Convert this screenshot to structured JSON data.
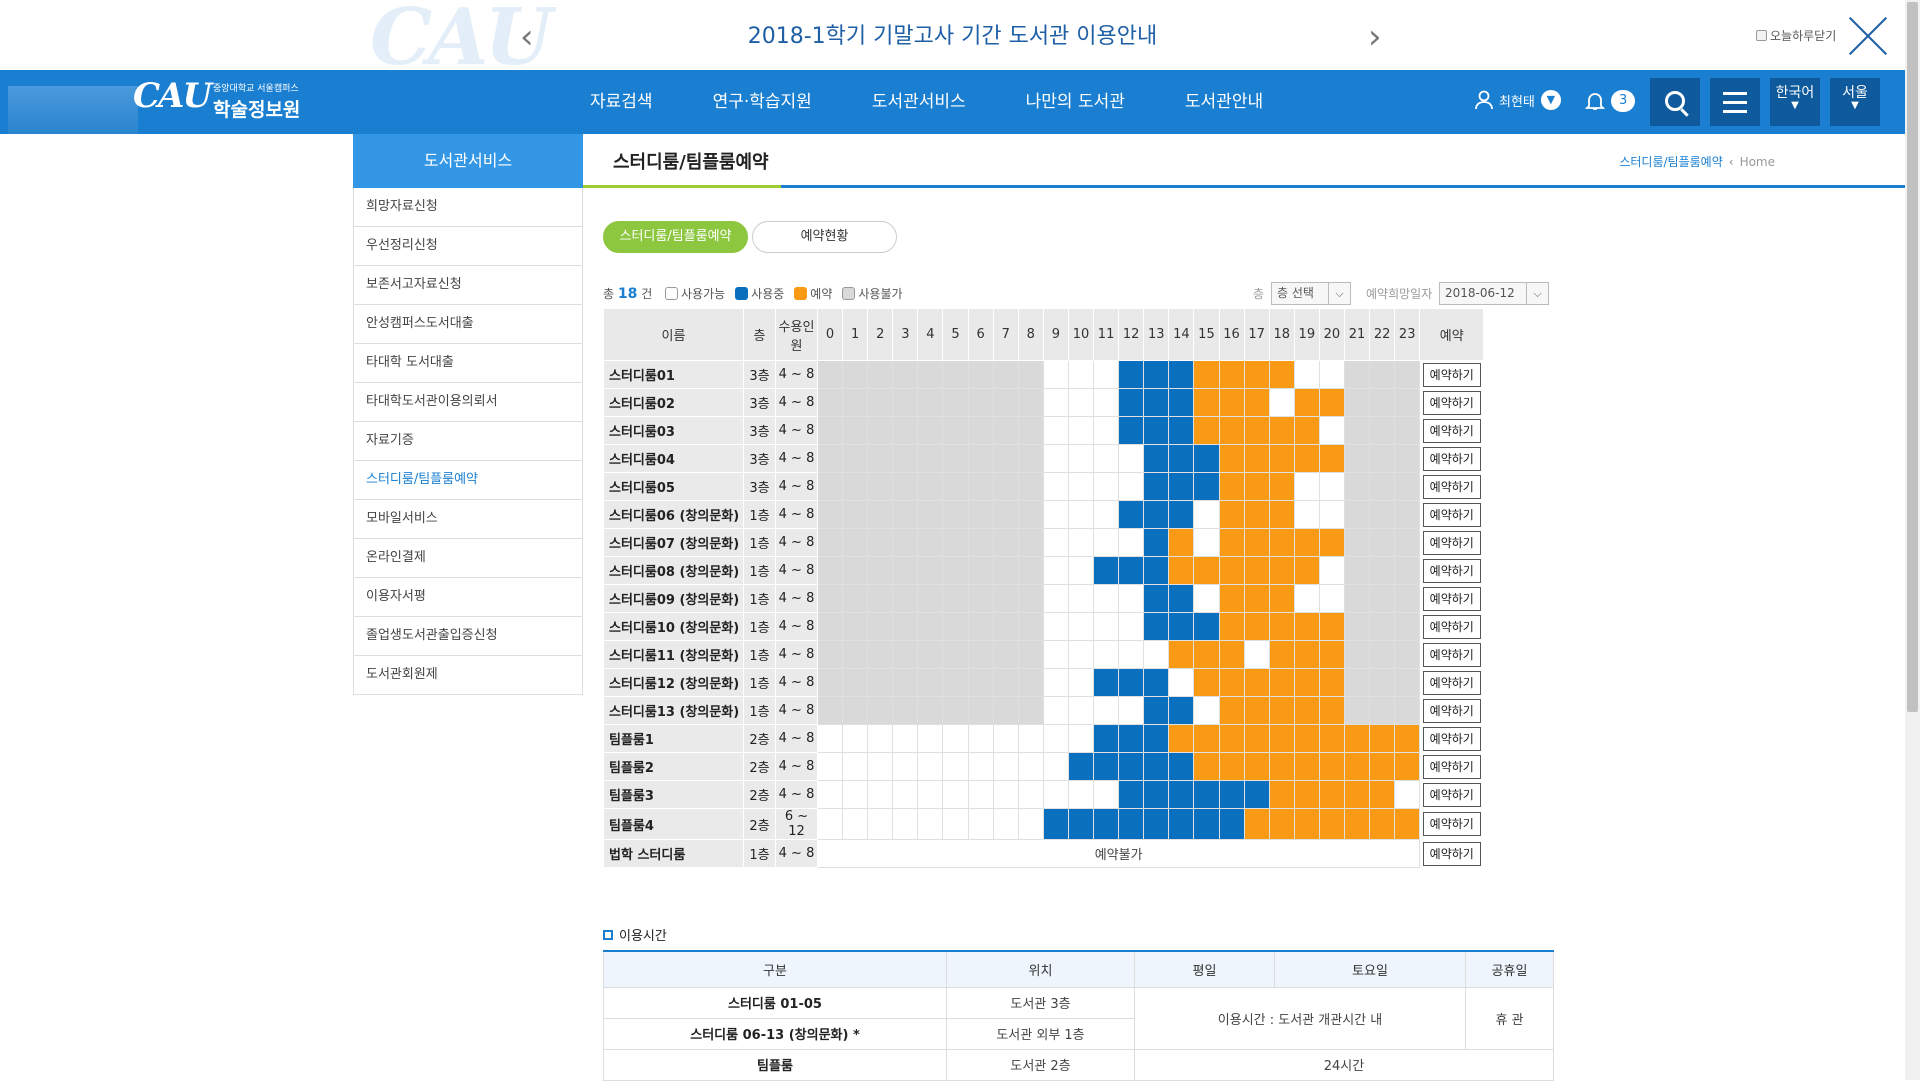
{
  "notice": {
    "title": "2018-1학기 기말고사 기간 도서관 이용안내",
    "today_close": "오늘하루닫기"
  },
  "header": {
    "logo_sub": "중앙대학교 서울캠퍼스",
    "logo_name": "학술정보원",
    "logo_mark": "CAU",
    "nav": [
      "자료검색",
      "연구·학습지원",
      "도서관서비스",
      "나만의 도서관",
      "도서관안내"
    ],
    "user": "최현태",
    "notif_count": "3",
    "lang": "한국어",
    "campus": "서울"
  },
  "lnb": {
    "title": "도서관서비스",
    "items": [
      "희망자료신청",
      "우선정리신청",
      "보존서고자료신청",
      "안성캠퍼스도서대출",
      "타대학 도서대출",
      "타대학도서관이용의뢰서",
      "자료기증",
      "스터디룸/팀플룸예약",
      "모바일서비스",
      "온라인결제",
      "이용자서평",
      "졸업생도서관출입증신청",
      "도서관회원제"
    ],
    "active": 7
  },
  "page": {
    "title": "스터디룸/팀플룸예약",
    "crumb_current": "스터디룸/팀플룸예약",
    "crumb_home": "Home"
  },
  "tabs": [
    "스터디룸/팀플룸예약",
    "예약현황"
  ],
  "filters": {
    "total_prefix": "총",
    "total": "18",
    "total_suffix": "건",
    "legend": [
      {
        "label": "사용가능",
        "color": "#ffffff"
      },
      {
        "label": "사용중",
        "color": "#0a6fbd"
      },
      {
        "label": "예약",
        "color": "#f89a14"
      },
      {
        "label": "사용불가",
        "color": "#d9d9d9"
      }
    ],
    "floor_label": "층",
    "floor_value": "층 선택",
    "date_label": "예약희망일자",
    "date_value": "2018-06-12"
  },
  "grid": {
    "headers": {
      "name": "이름",
      "floor": "층",
      "capacity": "수용인원",
      "reserve": "예약"
    },
    "hours": [
      "0",
      "1",
      "2",
      "3",
      "4",
      "5",
      "6",
      "7",
      "8",
      "9",
      "10",
      "11",
      "12",
      "13",
      "14",
      "15",
      "16",
      "17",
      "18",
      "19",
      "20",
      "21",
      "22",
      "23"
    ],
    "button": "예약하기",
    "unavailable": "예약불가",
    "rows": [
      {
        "name": "스터디룸01",
        "floor": "3층",
        "cap": "4 ~ 8",
        "s": "000000000111222333311000"
      },
      {
        "name": "스터디룸02",
        "floor": "3층",
        "cap": "4 ~ 8",
        "s": "000000000111222333133000"
      },
      {
        "name": "스터디룸03",
        "floor": "3층",
        "cap": "4 ~ 8",
        "s": "000000000111222333331000"
      },
      {
        "name": "스터디룸04",
        "floor": "3층",
        "cap": "4 ~ 8",
        "s": "000000000111122233333000"
      },
      {
        "name": "스터디룸05",
        "floor": "3층",
        "cap": "4 ~ 8",
        "s": "000000000111122233311000"
      },
      {
        "name": "스터디룸06 (창의문화)",
        "floor": "1층",
        "cap": "4 ~ 8",
        "s": "000000000111222133311000"
      },
      {
        "name": "스터디룸07 (창의문화)",
        "floor": "1층",
        "cap": "4 ~ 8",
        "s": "000000000111123133333000"
      },
      {
        "name": "스터디룸08 (창의문화)",
        "floor": "1층",
        "cap": "4 ~ 8",
        "s": "000000000112223333331000"
      },
      {
        "name": "스터디룸09 (창의문화)",
        "floor": "1층",
        "cap": "4 ~ 8",
        "s": "000000000111122133311000"
      },
      {
        "name": "스터디룸10 (창의문화)",
        "floor": "1층",
        "cap": "4 ~ 8",
        "s": "000000000111122233333000"
      },
      {
        "name": "스터디룸11 (창의문화)",
        "floor": "1층",
        "cap": "4 ~ 8",
        "s": "000000000111113331333000"
      },
      {
        "name": "스터디룸12 (창의문화)",
        "floor": "1층",
        "cap": "4 ~ 8",
        "s": "000000000112221333333000"
      },
      {
        "name": "스터디룸13 (창의문화)",
        "floor": "1층",
        "cap": "4 ~ 8",
        "s": "000000000111122133333000"
      },
      {
        "name": "팀플룸1",
        "floor": "2층",
        "cap": "4 ~ 8",
        "s": "111111111112223333333333"
      },
      {
        "name": "팀플룸2",
        "floor": "2층",
        "cap": "4 ~ 8",
        "s": "111111111122222333333333"
      },
      {
        "name": "팀플룸3",
        "floor": "2층",
        "cap": "4 ~ 8",
        "s": "111111111111222222333331"
      },
      {
        "name": "팀플룸4",
        "floor": "2층",
        "cap": "6 ~ 12",
        "s": "111111111222222223333333"
      },
      {
        "name": "법학 스터디룸",
        "floor": "1층",
        "cap": "4 ~ 8",
        "s": "NA"
      }
    ]
  },
  "info": {
    "heading": "이용시간",
    "headers": [
      "구분",
      "위치",
      "평일",
      "토요일",
      "공휴일"
    ],
    "rows": [
      {
        "name": "스터디룸 01-05",
        "loc": "도서관 3층"
      },
      {
        "name": "스터디룸 06-13 (창의문화) *",
        "loc": "도서관 외부 1층"
      },
      {
        "name": "팀플룸",
        "loc": "도서관 2층"
      }
    ],
    "merged_hours": "이용시간 : 도서관 개관시간 내",
    "holiday": "휴 관",
    "team_hours": "24시간"
  }
}
